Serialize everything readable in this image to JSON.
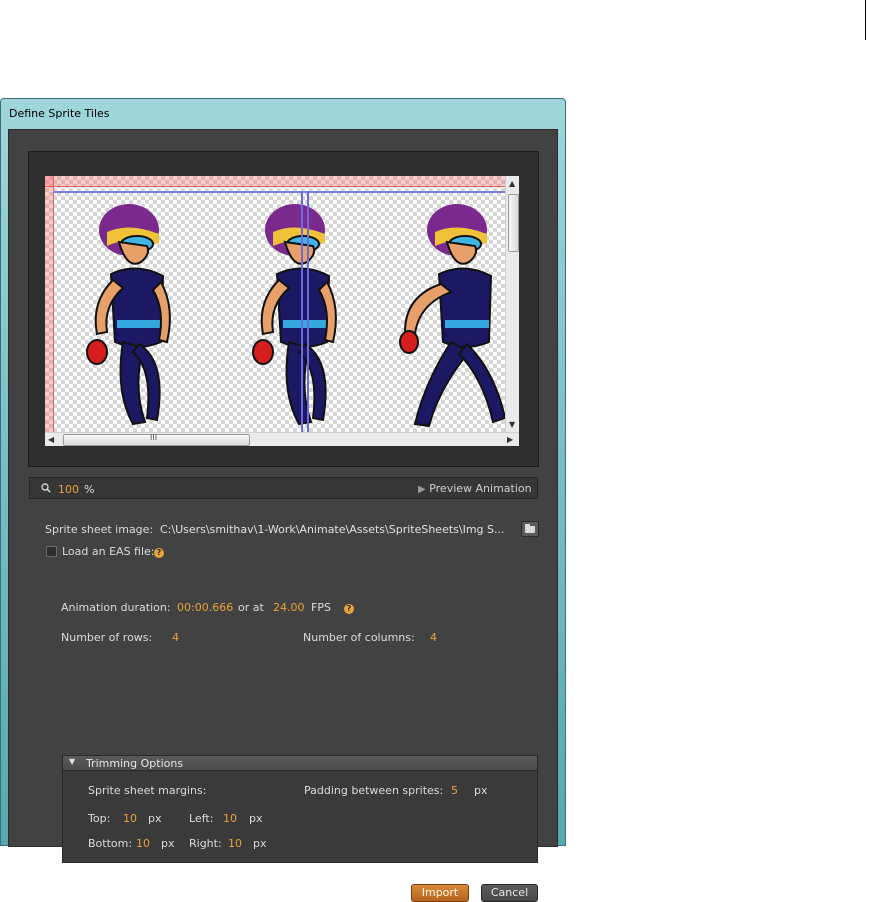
{
  "dialog": {
    "title": "Define Sprite Tiles"
  },
  "preview": {
    "zoom_value": "100",
    "zoom_unit": "%",
    "scroll_mark": "III",
    "preview_label": "Preview Animation"
  },
  "sprite_sheet": {
    "label": "Sprite sheet image:",
    "path": "C:\\Users\\smithav\\1-Work\\Animate\\Assets\\SpriteSheets\\Img S..."
  },
  "eas": {
    "label": "Load an EAS file:",
    "checked": false
  },
  "animation": {
    "duration_label": "Animation duration:",
    "duration_value": "00:00.666",
    "or_at": "or at",
    "fps_value": "24.00",
    "fps_label": "FPS"
  },
  "grid": {
    "rows_label": "Number of rows:",
    "rows_value": "4",
    "cols_label": "Number of columns:",
    "cols_value": "4"
  },
  "trimming": {
    "header": "Trimming Options",
    "margins_label": "Sprite sheet margins:",
    "padding_label": "Padding between sprites:",
    "padding_value": "5",
    "px": "px",
    "top_label": "Top:",
    "top_value": "10",
    "left_label": "Left:",
    "left_value": "10",
    "bottom_label": "Bottom:",
    "bottom_value": "10",
    "right_label": "Right:",
    "right_value": "10"
  },
  "buttons": {
    "import": "Import",
    "cancel": "Cancel"
  },
  "colors": {
    "accent": "#e8a33a",
    "panel": "#424242",
    "frame": "#7ec3c9"
  }
}
